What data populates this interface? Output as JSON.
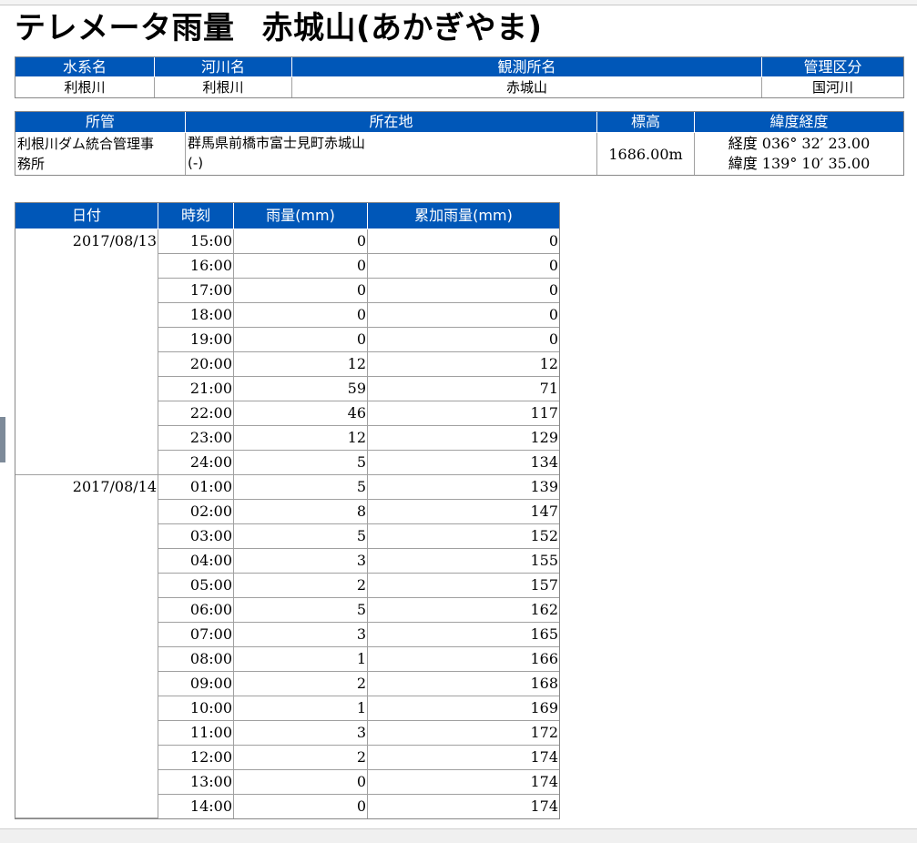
{
  "title": {
    "main": "テレメータ雨量",
    "station": "赤城山(あかぎやま)"
  },
  "info1": {
    "headers": [
      "水系名",
      "河川名",
      "観測所名",
      "管理区分"
    ],
    "values": [
      "利根川",
      "利根川",
      "赤城山",
      "国河川"
    ]
  },
  "info2": {
    "headers": [
      "所管",
      "所在地",
      "標高",
      "緯度経度"
    ],
    "office_line1": "利根川ダム統合管理事",
    "office_line2": "務所",
    "address_line1": "群馬県前橋市富士見町赤城山",
    "address_line2": "(-)",
    "elevation": "1686.00m",
    "coord_line1": "経度 036° 32′ 23.00",
    "coord_line2": "緯度 139° 10′ 35.00"
  },
  "rain": {
    "headers": [
      "日付",
      "時刻",
      "雨量(mm)",
      "累加雨量(mm)"
    ],
    "groups": [
      {
        "date": "2017/08/13",
        "rows": [
          {
            "time": "15:00",
            "rain": "0",
            "cum": "0"
          },
          {
            "time": "16:00",
            "rain": "0",
            "cum": "0"
          },
          {
            "time": "17:00",
            "rain": "0",
            "cum": "0"
          },
          {
            "time": "18:00",
            "rain": "0",
            "cum": "0"
          },
          {
            "time": "19:00",
            "rain": "0",
            "cum": "0"
          },
          {
            "time": "20:00",
            "rain": "12",
            "cum": "12"
          },
          {
            "time": "21:00",
            "rain": "59",
            "cum": "71"
          },
          {
            "time": "22:00",
            "rain": "46",
            "cum": "117"
          },
          {
            "time": "23:00",
            "rain": "12",
            "cum": "129"
          },
          {
            "time": "24:00",
            "rain": "5",
            "cum": "134"
          }
        ]
      },
      {
        "date": "2017/08/14",
        "rows": [
          {
            "time": "01:00",
            "rain": "5",
            "cum": "139"
          },
          {
            "time": "02:00",
            "rain": "8",
            "cum": "147"
          },
          {
            "time": "03:00",
            "rain": "5",
            "cum": "152"
          },
          {
            "time": "04:00",
            "rain": "3",
            "cum": "155"
          },
          {
            "time": "05:00",
            "rain": "2",
            "cum": "157"
          },
          {
            "time": "06:00",
            "rain": "5",
            "cum": "162"
          },
          {
            "time": "07:00",
            "rain": "3",
            "cum": "165"
          },
          {
            "time": "08:00",
            "rain": "1",
            "cum": "166"
          },
          {
            "time": "09:00",
            "rain": "2",
            "cum": "168"
          },
          {
            "time": "10:00",
            "rain": "1",
            "cum": "169"
          },
          {
            "time": "11:00",
            "rain": "3",
            "cum": "172"
          },
          {
            "time": "12:00",
            "rain": "2",
            "cum": "174"
          },
          {
            "time": "13:00",
            "rain": "0",
            "cum": "174"
          },
          {
            "time": "14:00",
            "rain": "0",
            "cum": "174"
          }
        ]
      }
    ]
  },
  "colors": {
    "header_bg": "#0057b8",
    "header_text": "#ffffff",
    "grid": "#a0a0a0"
  }
}
